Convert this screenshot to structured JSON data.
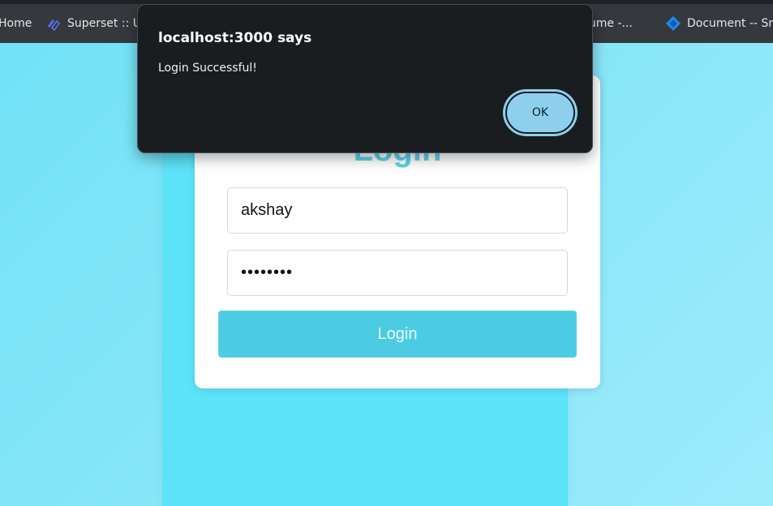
{
  "bookmarks": [
    {
      "label": "Home",
      "icon": "none"
    },
    {
      "label": "Superset :: Ur",
      "icon": "superset-icon"
    },
    {
      "label": "esume -...",
      "icon": "none"
    },
    {
      "label": "Document -- Sm",
      "icon": "diamond-icon"
    }
  ],
  "alert": {
    "title": "localhost:3000 says",
    "message": "Login Successful!",
    "ok_label": "OK"
  },
  "login": {
    "title": "Login",
    "username_value": "akshay",
    "password_value": "akshay12",
    "button_label": "Login"
  },
  "colors": {
    "accent": "#5ad4ec",
    "button": "#4ccce3",
    "dialog_bg": "#191d20",
    "ok_button": "#8ecfee"
  }
}
